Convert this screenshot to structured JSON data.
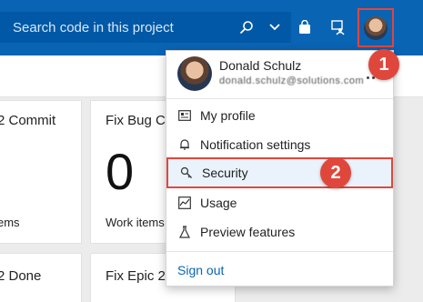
{
  "search": {
    "placeholder": "Search code in this project"
  },
  "icons": {
    "search": "search-icon",
    "chevron": "chevron-down-icon",
    "bag": "shopping-bag-icon",
    "feedback": "feedback-icon",
    "avatar": "user-avatar"
  },
  "cards": [
    {
      "title": "2 Commit",
      "big": "",
      "sub": "ems"
    },
    {
      "title": "Fix Bug Co",
      "big": "0",
      "sub": "Work items"
    },
    {
      "title": "2 Done",
      "big": "",
      "sub": ""
    },
    {
      "title": "Fix Epic 2",
      "big": "",
      "sub": ""
    }
  ],
  "profile_menu": {
    "name": "Donald Schulz",
    "email": "donald.schulz@solutions.com",
    "more_icon": "more-horizontal-icon",
    "items": [
      {
        "label": "My profile",
        "icon": "contact-card-icon"
      },
      {
        "label": "Notification settings",
        "icon": "bell-icon"
      },
      {
        "label": "Security",
        "icon": "key-icon"
      },
      {
        "label": "Usage",
        "icon": "chart-icon"
      },
      {
        "label": "Preview features",
        "icon": "flask-icon"
      }
    ],
    "sign_out": "Sign out"
  },
  "callouts": {
    "one": "1",
    "two": "2"
  },
  "colors": {
    "brand": "#0a64b4",
    "callout": "#e0473c",
    "highlight": "#eaf2fb"
  }
}
